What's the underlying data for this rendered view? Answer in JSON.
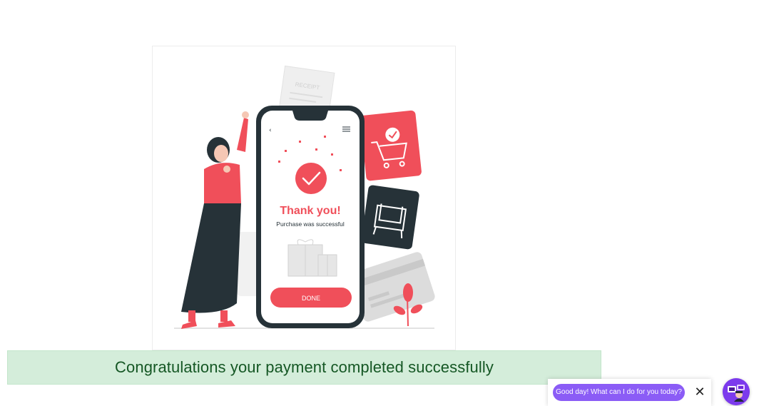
{
  "illustration": {
    "icon": "purchase-success-illustration",
    "receipt_label": "RECEIPT",
    "heading": "Thank you!",
    "subheading": "Purchase was successful",
    "done_label": "DONE",
    "accent_color": "#f04f5a",
    "dark_color": "#263238"
  },
  "banner": {
    "message": "Congratulations your payment completed successfully",
    "background_color": "#d4edda",
    "text_color": "#155724"
  },
  "chat": {
    "greeting": "Good day! What can I do for you today?",
    "close_symbol": "✕",
    "close_icon": "close-icon",
    "launcher_icon": "chatbot-avatar-icon",
    "bubble_color": "#8b5cf6"
  }
}
